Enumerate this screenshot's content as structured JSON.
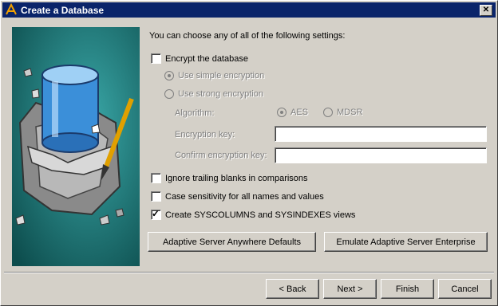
{
  "window": {
    "title": "Create a Database",
    "close_label": "✕"
  },
  "intro": "You can choose any of all of the following settings:",
  "encrypt": {
    "label": "Encrypt the database",
    "checked": false
  },
  "simple_enc": {
    "label": "Use simple encryption"
  },
  "strong_enc": {
    "label": "Use strong encryption"
  },
  "algorithm": {
    "label": "Algorithm:",
    "options": [
      "AES",
      "MDSR"
    ],
    "selected": "AES"
  },
  "key": {
    "label": "Encryption key:",
    "value": ""
  },
  "confirm_key": {
    "label": "Confirm encryption key:",
    "value": ""
  },
  "ignore_blanks": {
    "label": "Ignore trailing blanks in comparisons",
    "checked": false
  },
  "case_sens": {
    "label": "Case sensitivity for all names and values",
    "checked": false
  },
  "syscolumns": {
    "label": "Create SYSCOLUMNS and SYSINDEXES views",
    "checked": true
  },
  "buttons": {
    "asa_defaults": "Adaptive Server Anywhere Defaults",
    "emulate_ase": "Emulate Adaptive Server Enterprise",
    "back": "< Back",
    "next": "Next >",
    "finish": "Finish",
    "cancel": "Cancel"
  }
}
